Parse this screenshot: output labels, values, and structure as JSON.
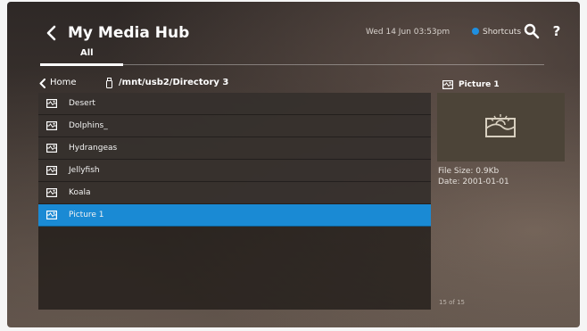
{
  "header": {
    "back_icon": "chevron-left",
    "title": "My Media Hub",
    "datetime": "Wed 14 Jun 03:53pm",
    "shortcuts_label": "Shortcuts",
    "shortcuts_dot_color": "#1f8fe0",
    "search_icon": "magnifier",
    "help_label": "?"
  },
  "tabs": [
    {
      "label": "All",
      "active": true
    }
  ],
  "path_bar": {
    "home_label": "Home",
    "storage_icon": "usb-stick",
    "path": "/mnt/usb2/Directory 3"
  },
  "files": [
    {
      "name": "Desert",
      "icon": "image-file"
    },
    {
      "name": "Dolphins_",
      "icon": "image-file"
    },
    {
      "name": "Hydrangeas",
      "icon": "image-file"
    },
    {
      "name": "Jellyfish",
      "icon": "image-file"
    },
    {
      "name": "Koala",
      "icon": "image-file"
    },
    {
      "name": "Picture 1",
      "icon": "image-file",
      "selected": true
    }
  ],
  "selection_color": "#1a8ad4",
  "preview": {
    "name": "Picture 1",
    "icon": "image-file",
    "thumbnail_icon": "landscape-image",
    "file_size": "File Size: 0.9Kb",
    "date": "Date: 2001-01-01",
    "count": "15 of 15"
  }
}
